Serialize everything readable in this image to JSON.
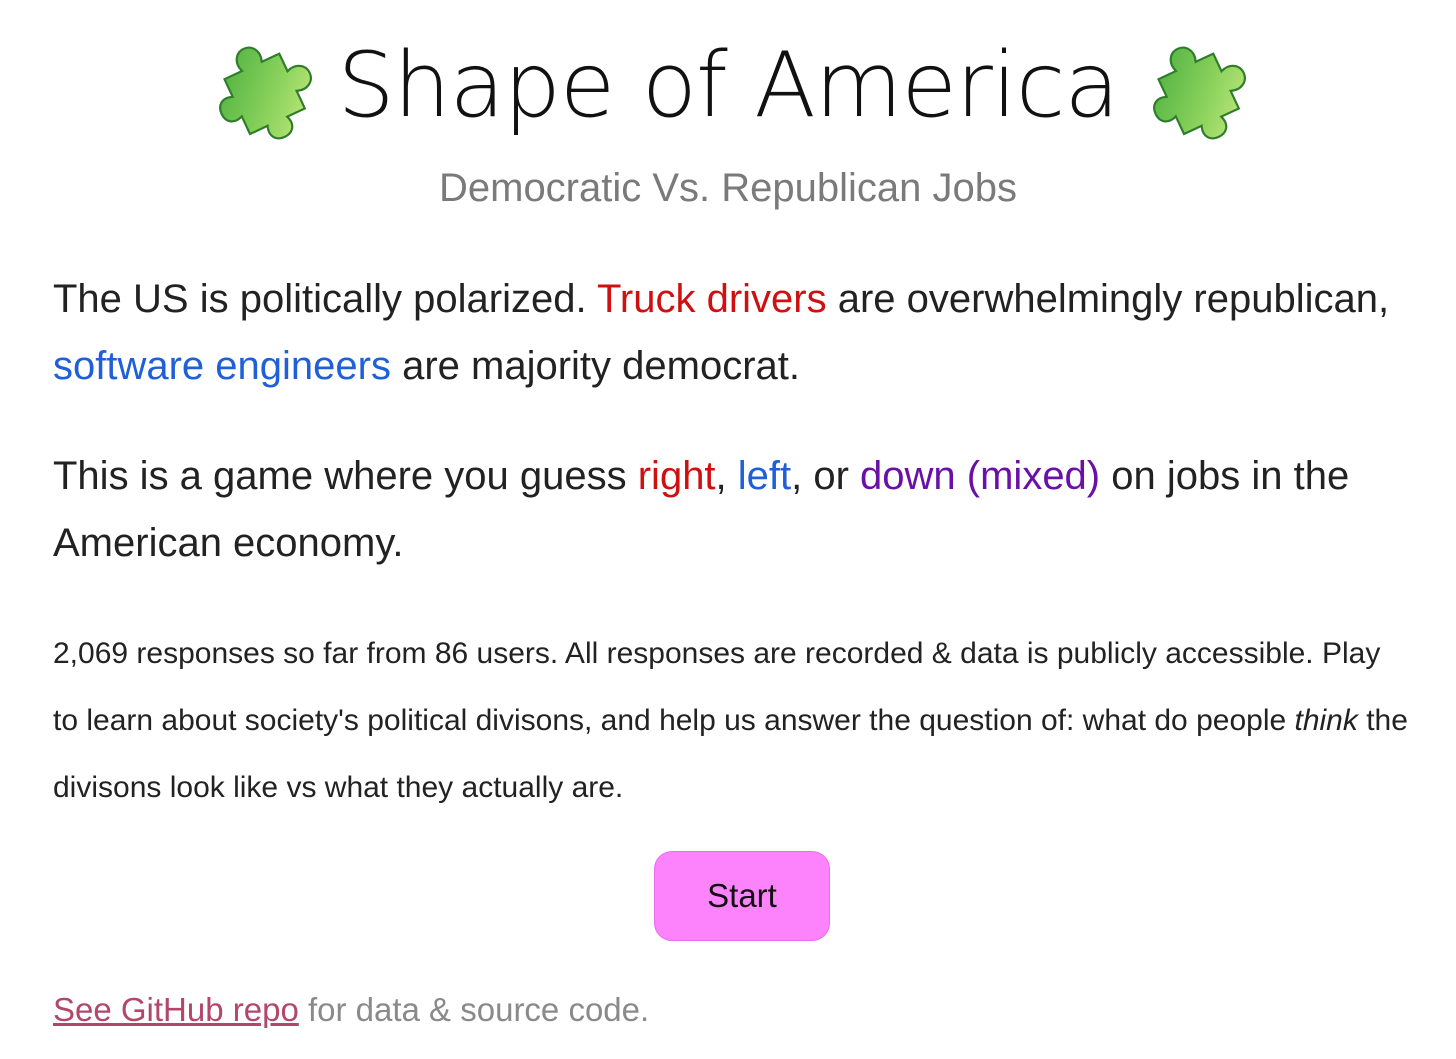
{
  "header": {
    "title": "Shape of America",
    "subtitle": "Democratic Vs. Republican Jobs",
    "icon_left": "puzzle-piece-icon",
    "icon_right": "puzzle-piece-icon"
  },
  "intro1": {
    "part1": "The US is politically polarized. ",
    "truck": "Truck drivers",
    "part2": " are overwhelmingly republican, ",
    "software": "software engineers",
    "part3": " are majority democrat."
  },
  "intro2": {
    "part1": "This is a game where you guess ",
    "right": "right",
    "comma1": ", ",
    "left": "left",
    "part2": ", or ",
    "down": "down (mixed)",
    "part3": " on jobs in the American economy."
  },
  "stats": {
    "part1": "2,069 responses so far from 86 users. All responses are recorded & data is publicly accessible. Play to learn about society's political divisons, and help us answer the question of: what do people ",
    "think": "think",
    "part2": " the divisons look like vs what they actually are."
  },
  "start_button": {
    "label": "Start"
  },
  "footer": {
    "link": "See GitHub repo",
    "text": " for data & source code."
  },
  "colors": {
    "republican": "#d01010",
    "democrat": "#1f5fd8",
    "mixed": "#6a0fa8",
    "button": "#fc83fc",
    "link": "#b2476a"
  }
}
